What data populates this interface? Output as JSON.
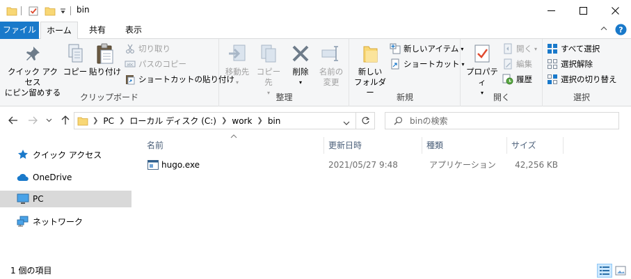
{
  "window": {
    "title": "bin"
  },
  "ribbon_tabs": {
    "file": "ファイル",
    "home": "ホーム",
    "share": "共有",
    "view": "表示"
  },
  "clipboard": {
    "pin": "クイック アクセス\nにピン留めする",
    "copy": "コピー",
    "paste": "貼り付け",
    "cut": "切り取り",
    "copy_path": "パスのコピー",
    "paste_shortcut": "ショートカットの貼り付け",
    "label": "クリップボード"
  },
  "organize": {
    "move_to": "移動先",
    "copy_to": "コピー先",
    "delete": "削除",
    "rename": "名前の\n変更",
    "label": "整理"
  },
  "new": {
    "new_folder": "新しい\nフォルダー",
    "new_item": "新しいアイテム",
    "shortcut": "ショートカット",
    "label": "新規"
  },
  "open": {
    "properties": "プロパティ",
    "open": "開く",
    "edit": "編集",
    "history": "履歴",
    "label": "開く"
  },
  "select": {
    "select_all": "すべて選択",
    "select_none": "選択解除",
    "invert": "選択の切り替え",
    "label": "選択"
  },
  "address": {
    "crumbs": [
      "PC",
      "ローカル ディスク (C:)",
      "work",
      "bin"
    ],
    "search_placeholder": "binの検索"
  },
  "nav": {
    "items": [
      {
        "label": "クイック アクセス"
      },
      {
        "label": "OneDrive"
      },
      {
        "label": "PC"
      },
      {
        "label": "ネットワーク"
      }
    ]
  },
  "columns": {
    "name": "名前",
    "date": "更新日時",
    "type": "種類",
    "size": "サイズ"
  },
  "files": [
    {
      "name": "hugo.exe",
      "date": "2021/05/27 9:48",
      "type": "アプリケーション",
      "size": "42,256 KB"
    }
  ],
  "status": {
    "count": "1 個の項目"
  },
  "colors": {
    "accent": "#1979ca",
    "ribbon_bg": "#f5f6f7",
    "selected_nav": "#d9d9d9",
    "header_text": "#4c607a"
  }
}
